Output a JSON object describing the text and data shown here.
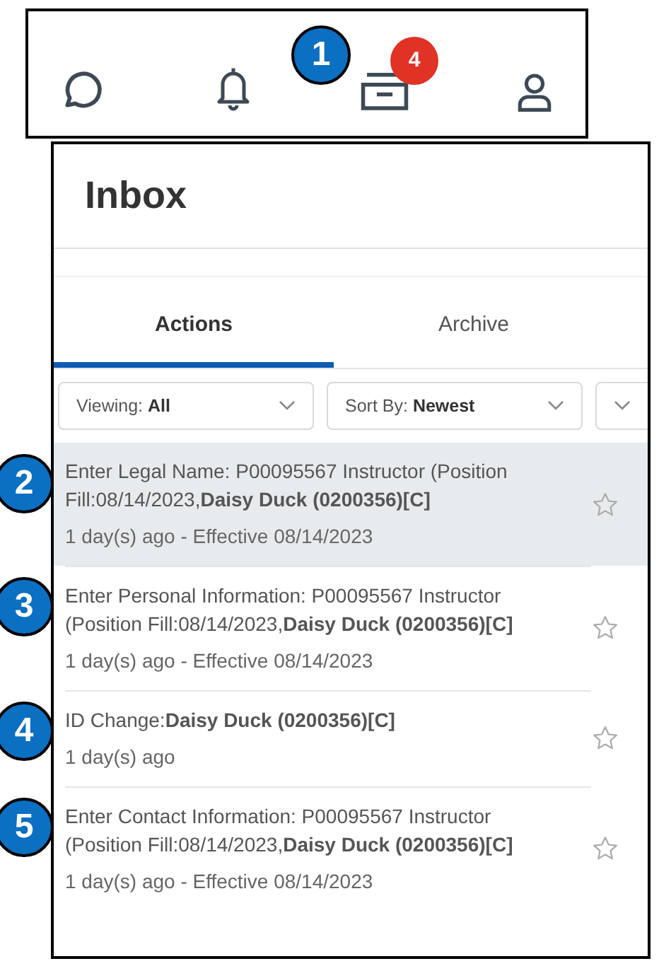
{
  "top_bar": {
    "icons": [
      {
        "kind": "chat"
      },
      {
        "kind": "bell"
      },
      {
        "kind": "inbox",
        "badge": "4",
        "callout": "1"
      },
      {
        "kind": "person"
      }
    ]
  },
  "inbox": {
    "title": "Inbox",
    "tabs": [
      {
        "label": "Actions",
        "selected": true
      },
      {
        "label": "Archive",
        "selected": false
      }
    ],
    "filters": [
      {
        "kind": "labeled",
        "label": "Viewing:",
        "value": "All"
      },
      {
        "kind": "labeled",
        "label": "Sort By:",
        "value": "Newest"
      },
      {
        "kind": "more"
      }
    ],
    "items": [
      {
        "callout": "2",
        "title": "Enter Legal Name: P00095567 Instructor (Position Fill:08/14/2023,**Daisy Duck (0200356)[C]**",
        "meta": "1 day(s) ago - Effective 08/14/2023",
        "selected": true
      },
      {
        "callout": "3",
        "title": "Enter Personal Information: P00095567 Instructor (Position Fill:08/14/2023,**Daisy Duck (0200356)[C]**",
        "meta": "1 day(s) ago - Effective 08/14/2023",
        "selected": false
      },
      {
        "callout": "4",
        "title": "ID Change:**Daisy Duck (0200356)[C]**",
        "meta": "1 day(s) ago",
        "selected": false
      },
      {
        "callout": "5",
        "title": "Enter Contact Information: P00095567 Instructor (Position Fill:08/14/2023,**Daisy Duck (0200356)[C]**",
        "meta": "1 day(s) ago - Effective 08/14/2023",
        "selected": false
      }
    ]
  }
}
